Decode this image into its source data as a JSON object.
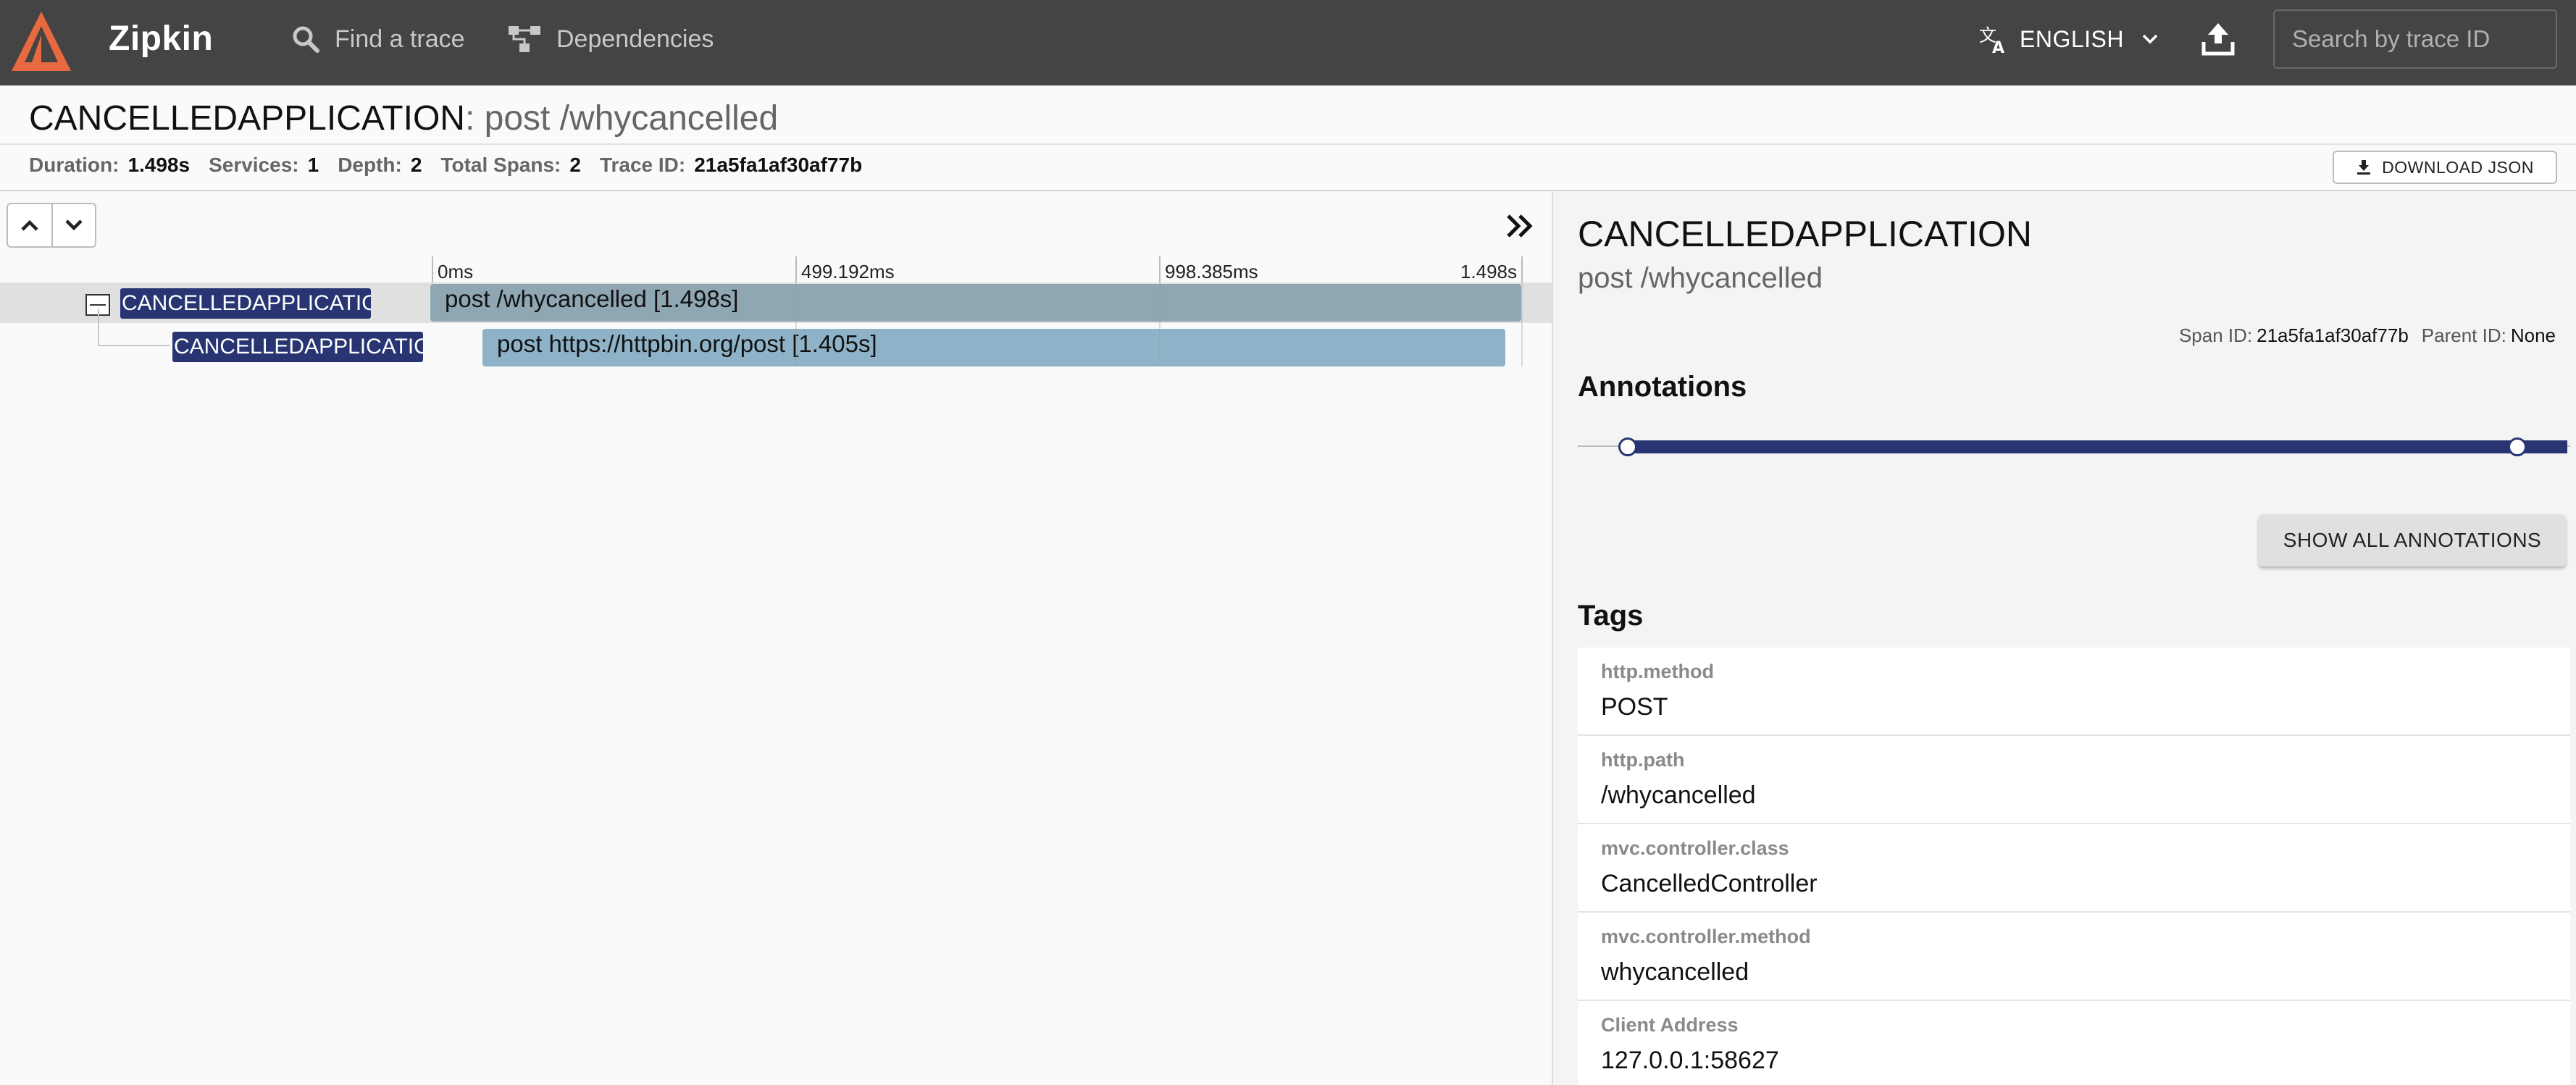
{
  "header": {
    "brand": "Zipkin",
    "nav": {
      "find_trace": "Find a trace",
      "dependencies": "Dependencies"
    },
    "language": "ENGLISH",
    "search_placeholder": "Search by trace ID",
    "colors": {
      "bar": "#444444",
      "logo": "#e8693f"
    }
  },
  "trace": {
    "service": "CANCELLEDAPPLICATION",
    "separator": ": ",
    "span_name": "post /whycancelled",
    "meta": [
      {
        "label": "Duration:",
        "value": "1.498s"
      },
      {
        "label": "Services:",
        "value": "1"
      },
      {
        "label": "Depth:",
        "value": "2"
      },
      {
        "label": "Total Spans:",
        "value": "2"
      },
      {
        "label": "Trace ID:",
        "value": "21a5fa1af30af77b"
      }
    ],
    "download_label": "DOWNLOAD JSON"
  },
  "timeline": {
    "ticks": [
      "0ms",
      "499.192ms",
      "998.385ms",
      "1.498s"
    ],
    "spans": [
      {
        "service": "CANCELLEDAPPLICATION",
        "label": "post /whycancelled [1.498s]"
      },
      {
        "service": "CANCELLEDAPPLICATION",
        "label": "post https://httpbin.org/post [1.405s]"
      }
    ]
  },
  "detail": {
    "service": "CANCELLEDAPPLICATION",
    "span_name": "post /whycancelled",
    "span_id_label": "Span ID:",
    "span_id": "21a5fa1af30af77b",
    "parent_id_label": "Parent ID:",
    "parent_id": "None",
    "annotations_title": "Annotations",
    "show_all_label": "SHOW ALL ANNOTATIONS",
    "tags_title": "Tags",
    "tags": [
      {
        "key": "http.method",
        "value": "POST"
      },
      {
        "key": "http.path",
        "value": "/whycancelled"
      },
      {
        "key": "mvc.controller.class",
        "value": "CancelledController"
      },
      {
        "key": "mvc.controller.method",
        "value": "whycancelled"
      },
      {
        "key": "Client Address",
        "value": "127.0.0.1:58627"
      }
    ],
    "accent": "#283572"
  }
}
